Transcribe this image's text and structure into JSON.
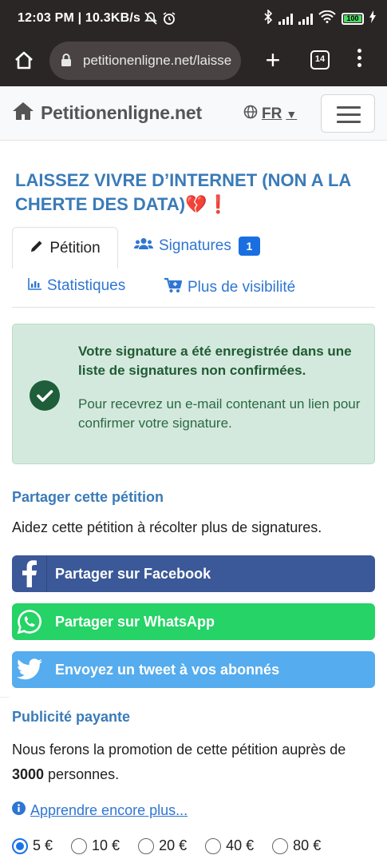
{
  "status_bar": {
    "time": "12:03 PM | 10.3KB/s",
    "battery_level": "100"
  },
  "browser": {
    "url": "petitionenligne.net/laisse",
    "tab_count": "14"
  },
  "site_nav": {
    "brand": "Petitionenligne.net",
    "language": "FR",
    "language_caret": "▼"
  },
  "petition": {
    "title": "LAISSEZ VIVRE D’INTERNET (NON A LA CHERTE DES DATA)",
    "title_emoji_heart": "💔",
    "title_emoji_bang": "❗"
  },
  "tabs": {
    "petition": "Pétition",
    "signatures": "Signatures",
    "signatures_count": "1",
    "statistics": "Statistiques",
    "visibility": "Plus de visibilité"
  },
  "alert": {
    "strong": "Votre signature a été enregistrée dans une liste de signatures non confirmées.",
    "message": "Pour recevrez un e-mail contenant un lien pour confirmer votre signature."
  },
  "share": {
    "heading": "Partager cette pétition",
    "text": "Aidez cette pétition à récolter plus de signatures.",
    "facebook": "Partager sur Facebook",
    "whatsapp": "Partager sur WhatsApp",
    "twitter": "Envoyez un tweet à vos abonnés"
  },
  "paid": {
    "heading": "Publicité payante",
    "text_before": "Nous ferons la promotion de cette pétition auprès de ",
    "count": "3000",
    "text_after": " personnes.",
    "learn_more": "Apprendre encore plus...",
    "selected_amount": "5 €",
    "amounts": [
      "5 €",
      "10 €",
      "20 €",
      "40 €",
      "80 €"
    ]
  },
  "colors": {
    "facebook": "#3b5998",
    "whatsapp": "#25d366",
    "twitter": "#55acee",
    "link": "#2f76d2",
    "heading": "#3a7bb8",
    "success_bg": "#d4e9dd"
  }
}
